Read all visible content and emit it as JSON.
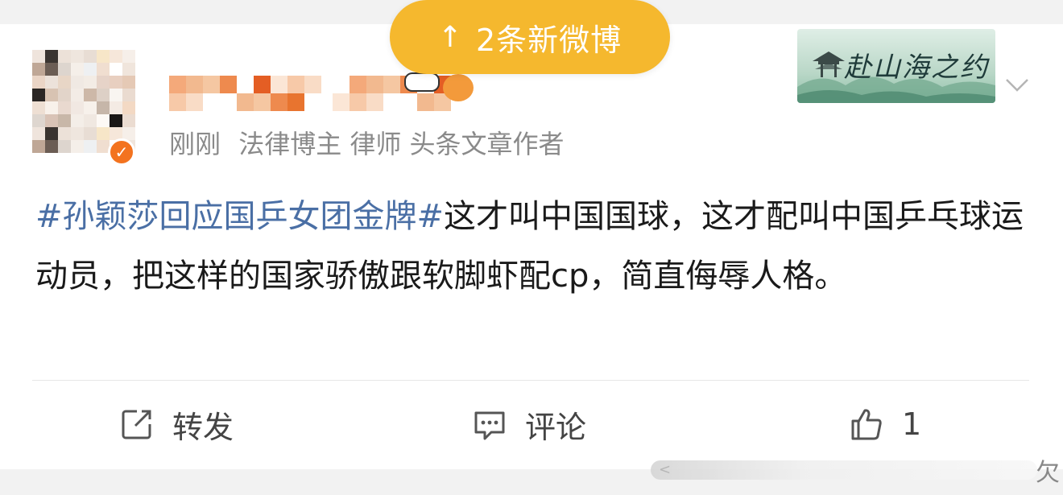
{
  "new_posts_pill": {
    "arrow": "↑",
    "label": "2条新微博",
    "color": "#f5b82e"
  },
  "post": {
    "author": {
      "verified_icon": "check-badge-icon",
      "badge_color": "#f3731f"
    },
    "meta": {
      "time": "刚刚",
      "tags": "法律博主 律师 头条文章作者"
    },
    "decoration_text": "赴山海之约",
    "hashtag": "#孙颖莎回应国乒女团金牌#",
    "body": "这才叫中国国球，这才配叫中国乒乓球运动员，把这样的国家骄傲跟软脚虾配cp，简直侮辱人格。"
  },
  "actions": {
    "repost_label": "转发",
    "comment_label": "评论",
    "like_count": "1"
  },
  "edge_char": "欠",
  "colors": {
    "hashtag": "#4a6fa5",
    "meta_text": "#8a8a8a"
  }
}
